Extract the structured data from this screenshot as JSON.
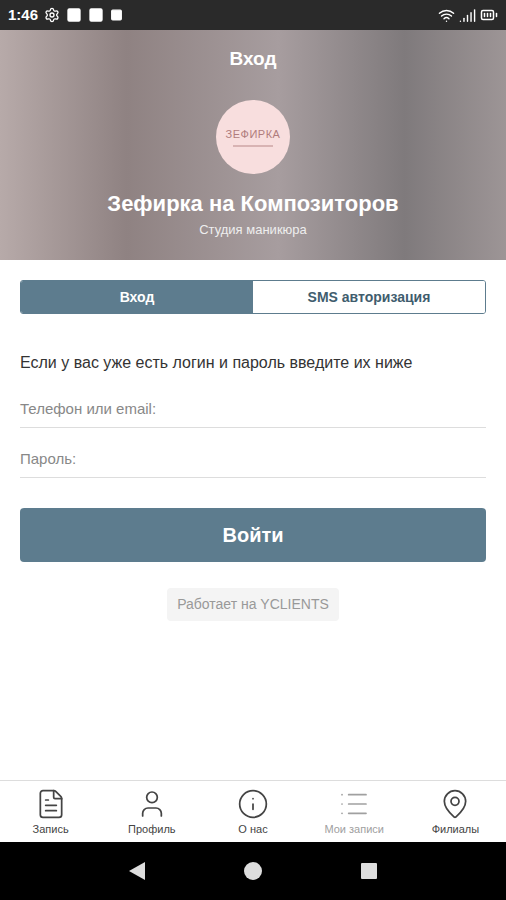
{
  "status_bar": {
    "time": "1:46"
  },
  "header": {
    "title": "Вход",
    "logo_text": "ЗЕФИРКА",
    "studio_name": "Зефирка на Композиторов",
    "studio_type": "Студия маникюра"
  },
  "tabs": [
    {
      "label": "Вход",
      "selected": true
    },
    {
      "label": "SMS авторизация",
      "selected": false
    }
  ],
  "hint": "Если у вас уже есть логин и пароль введите их ниже",
  "fields": [
    {
      "placeholder": "Телефон или email:"
    },
    {
      "placeholder": "Пароль:"
    }
  ],
  "submit_button": "Войти",
  "powered_by": "Работает на YCLIENTS",
  "bottom_nav": [
    {
      "label": "Запись",
      "disabled": false
    },
    {
      "label": "Профиль",
      "disabled": false
    },
    {
      "label": "О нас",
      "disabled": false
    },
    {
      "label": "Мои записи",
      "disabled": true
    },
    {
      "label": "Филиалы",
      "disabled": false
    }
  ]
}
